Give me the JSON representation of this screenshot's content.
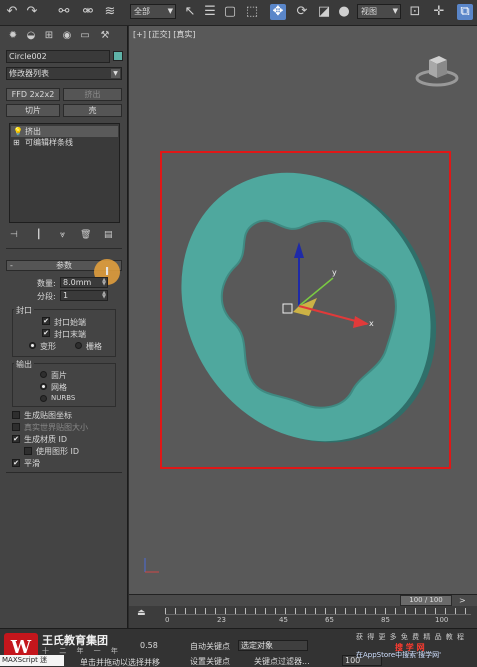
{
  "toolbar": {
    "icons": [
      "undo-icon",
      "redo-icon",
      "link-icon",
      "unlink-icon",
      "bind-space-warp-icon"
    ],
    "selection_filter": "全部",
    "view_select": "视图"
  },
  "panel": {
    "object_name": "Circle002",
    "object_color": "#5fb3a8",
    "modifier_list": "修改器列表",
    "buttons": {
      "ffd": "FFD 2x2x2",
      "extrude": "挤出",
      "slice": "切片",
      "shell": "壳"
    },
    "stack": [
      "挤出",
      "可编辑样条线"
    ],
    "rollout_title": "参数",
    "amount_label": "数量:",
    "amount_value": "8.0mm",
    "segments_label": "分段:",
    "segments_value": "1",
    "capping": {
      "title": "封口",
      "cap_start": "封口始端",
      "cap_end": "封口末端",
      "morph": "变形",
      "grid": "栅格"
    },
    "output": {
      "title": "输出",
      "patch": "面片",
      "mesh": "网格",
      "nurbs": "NURBS"
    },
    "gen_mapping": "生成贴图坐标",
    "real_world": "真实世界贴图大小",
    "gen_mat_ids": "生成材质 ID",
    "use_shape_ids": "使用图形 ID",
    "smooth": "平滑",
    "cursor_glyph": "I"
  },
  "viewport": {
    "label": "[+] [正交] [真实]",
    "gizmo_x": "x",
    "gizmo_y": "y",
    "ring_color": "#4fa89e"
  },
  "timeline": {
    "slider": "100 / 100",
    "ticks": [
      "0",
      "23",
      "45",
      "65",
      "85",
      "100"
    ]
  },
  "status": {
    "brand": "王氏教育集团",
    "brand_sub": "十 二 年 一 年",
    "maxscript": "MAXScript 迷",
    "prompt": "单击并拖动以选择并移",
    "frame_value": "0.58",
    "auto_key": "自动关键点",
    "set_key": "设置关键点",
    "key_target": "选定对象",
    "key_filters": "关键点过滤器...",
    "frame_field": "100",
    "wm_top": "获 得 更 多 免 费 精 品 教 程",
    "wm_red": "搜 学 网",
    "wm_blue": "在AppStore中搜索'搜学网'"
  }
}
